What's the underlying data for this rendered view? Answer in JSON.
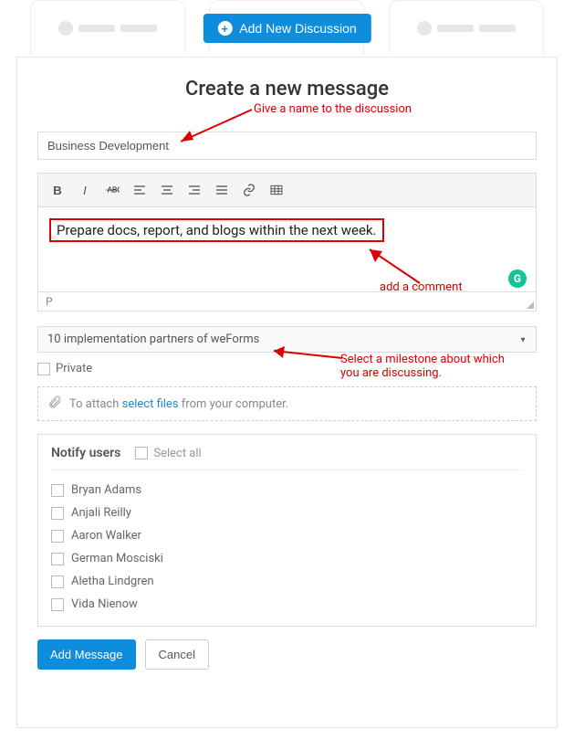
{
  "header": {
    "add_button": "Add New Discussion"
  },
  "form": {
    "title": "Create a new message",
    "subject_value": "Business Development",
    "editor_text": "Prepare docs, report, and blogs within the next week.",
    "editor_status": "P",
    "milestone_value": "10 implementation partners of weForms",
    "private_label": "Private",
    "attach_prefix": "To attach",
    "attach_link": "select files",
    "attach_suffix": "from your computer.",
    "notify_title": "Notify users",
    "select_all_label": "Select all",
    "users": [
      "Bryan Adams",
      "Anjali Reilly",
      "Aaron Walker",
      "German Mosciski",
      "Aletha Lindgren",
      "Vida Nienow"
    ],
    "submit_label": "Add Message",
    "cancel_label": "Cancel"
  },
  "toolbar": {
    "buttons": [
      "bold",
      "italic",
      "strikethrough",
      "align-left",
      "align-center",
      "align-right",
      "align-justify",
      "link",
      "table"
    ]
  },
  "annotations": {
    "name_hint": "Give a name to the discussion",
    "comment_hint": "add a comment",
    "milestone_hint_line1": "Select a milestone about which",
    "milestone_hint_line2": "you are discussing."
  },
  "grammarly_letter": "G"
}
